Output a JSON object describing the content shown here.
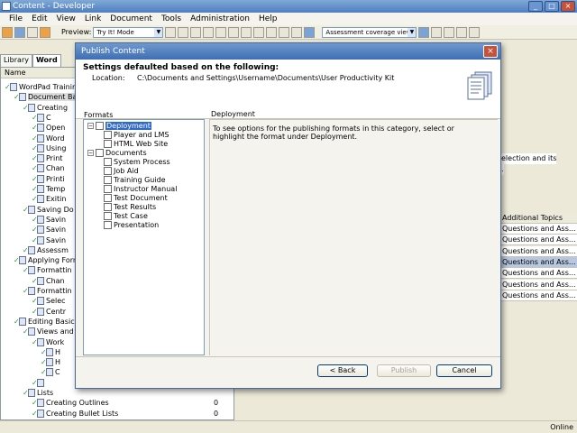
{
  "window": {
    "title": "Content - Developer",
    "minimize": "_",
    "maximize": "□",
    "close": "×"
  },
  "menu": [
    "File",
    "Edit",
    "View",
    "Link",
    "Document",
    "Tools",
    "Administration",
    "Help"
  ],
  "toolbar": {
    "preview_label": "Preview:",
    "preview_value": "Try It! Mode",
    "view_value": "Assessment coverage view"
  },
  "tabs": [
    "Library",
    "Word"
  ],
  "tree": {
    "header": "Name",
    "items": [
      {
        "label": "WordPad Training",
        "indent": 0
      },
      {
        "label": "Document Ba",
        "indent": 1
      },
      {
        "label": "Creating",
        "indent": 2
      },
      {
        "label": "C",
        "indent": 3
      },
      {
        "label": "Open",
        "indent": 3
      },
      {
        "label": "Word",
        "indent": 3
      },
      {
        "label": "Using",
        "indent": 3
      },
      {
        "label": "Print",
        "indent": 3
      },
      {
        "label": "Chan",
        "indent": 3
      },
      {
        "label": "Printi",
        "indent": 3
      },
      {
        "label": "Temp",
        "indent": 3
      },
      {
        "label": "Exitin",
        "indent": 3
      },
      {
        "label": "Saving Do",
        "indent": 2
      },
      {
        "label": "Savin",
        "indent": 3
      },
      {
        "label": "Savin",
        "indent": 3
      },
      {
        "label": "Savin",
        "indent": 3
      },
      {
        "label": "Assessm",
        "indent": 2
      },
      {
        "label": "Applying Forn",
        "indent": 1
      },
      {
        "label": "Formattin",
        "indent": 2
      },
      {
        "label": "Chan",
        "indent": 3
      },
      {
        "label": "Formattin",
        "indent": 2
      },
      {
        "label": "Selec",
        "indent": 3
      },
      {
        "label": "Centr",
        "indent": 3
      },
      {
        "label": "Editing Basics",
        "indent": 1
      },
      {
        "label": "Views and",
        "indent": 2
      },
      {
        "label": "Work",
        "indent": 3
      },
      {
        "label": "H",
        "indent": 4
      },
      {
        "label": "H",
        "indent": 4
      },
      {
        "label": "C",
        "indent": 4
      },
      {
        "label": "",
        "indent": 3
      },
      {
        "label": "Lists",
        "indent": 2
      },
      {
        "label": "Creating Outlines",
        "indent": 3,
        "count": "0"
      },
      {
        "label": "Creating Bullet Lists",
        "indent": 3,
        "count": "0"
      }
    ]
  },
  "right_panel": {
    "text1": "election and its",
    "text2": ".",
    "column_header": "Additional Topics",
    "rows": [
      "Questions and Ass...",
      "Questions and Ass...",
      "Questions and Ass...",
      "Questions and Ass...",
      "Questions and Ass...",
      "Questions and Ass...",
      "Questions and Ass..."
    ]
  },
  "status": {
    "online": "Online"
  },
  "dialog": {
    "title": "Publish Content",
    "heading": "Settings defaulted based on the following:",
    "location_label": "Location:",
    "location_value": "C:\\Documents and Settings\\Username\\Documents\\User Productivity Kit",
    "formats_label": "Formats",
    "formats": [
      {
        "label": "Deployment",
        "level": 0,
        "expander": true,
        "selected": true
      },
      {
        "label": "Player and LMS",
        "level": 1
      },
      {
        "label": "HTML Web Site",
        "level": 1
      },
      {
        "label": "Documents",
        "level": 0,
        "expander": true
      },
      {
        "label": "System Process",
        "level": 1
      },
      {
        "label": "Job Aid",
        "level": 1
      },
      {
        "label": "Training Guide",
        "level": 1
      },
      {
        "label": "Instructor Manual",
        "level": 1
      },
      {
        "label": "Test Document",
        "level": 1
      },
      {
        "label": "Test Results",
        "level": 1
      },
      {
        "label": "Test Case",
        "level": 1
      },
      {
        "label": "Presentation",
        "level": 1
      }
    ],
    "section_title": "Deployment",
    "section_text": "To see options for the publishing formats in this category, select or highlight the format under Deployment.",
    "back_button": "< Back",
    "publish_button": "Publish",
    "cancel_button": "Cancel",
    "close_button": "×"
  }
}
